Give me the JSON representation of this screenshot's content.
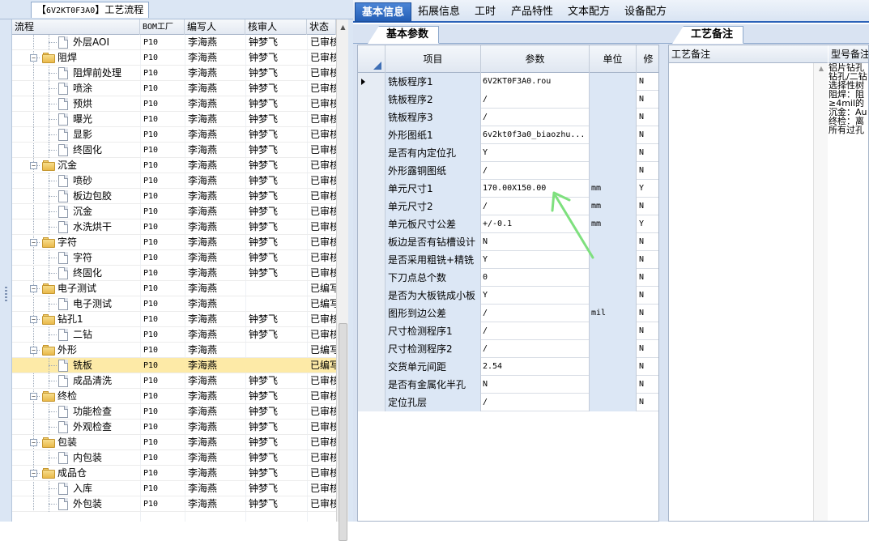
{
  "left": {
    "tab_code": "6V2KT0F3A0",
    "tab_bracket_open": "【",
    "tab_bracket_close": "】",
    "tab_title": "工艺流程",
    "columns": [
      "流程",
      "BOM工厂",
      "编写人",
      "核审人",
      "状态"
    ],
    "rows": [
      {
        "level": 1,
        "kind": "doc",
        "name": "外层AOI",
        "factory": "P10",
        "writer": "李海燕",
        "reviewer": "钟梦飞",
        "status": "已审核"
      },
      {
        "level": 0,
        "kind": "folder",
        "name": "阻焊",
        "factory": "P10",
        "writer": "李海燕",
        "reviewer": "钟梦飞",
        "status": "已审核"
      },
      {
        "level": 1,
        "kind": "doc",
        "name": "阻焊前处理",
        "factory": "P10",
        "writer": "李海燕",
        "reviewer": "钟梦飞",
        "status": "已审核"
      },
      {
        "level": 1,
        "kind": "doc",
        "name": "喷涂",
        "factory": "P10",
        "writer": "李海燕",
        "reviewer": "钟梦飞",
        "status": "已审核"
      },
      {
        "level": 1,
        "kind": "doc",
        "name": "预烘",
        "factory": "P10",
        "writer": "李海燕",
        "reviewer": "钟梦飞",
        "status": "已审核"
      },
      {
        "level": 1,
        "kind": "doc",
        "name": "曝光",
        "factory": "P10",
        "writer": "李海燕",
        "reviewer": "钟梦飞",
        "status": "已审核"
      },
      {
        "level": 1,
        "kind": "doc",
        "name": "显影",
        "factory": "P10",
        "writer": "李海燕",
        "reviewer": "钟梦飞",
        "status": "已审核"
      },
      {
        "level": 1,
        "kind": "doc",
        "name": "终固化",
        "factory": "P10",
        "writer": "李海燕",
        "reviewer": "钟梦飞",
        "status": "已审核"
      },
      {
        "level": 0,
        "kind": "folder",
        "name": "沉金",
        "factory": "P10",
        "writer": "李海燕",
        "reviewer": "钟梦飞",
        "status": "已审核"
      },
      {
        "level": 1,
        "kind": "doc",
        "name": "喷砂",
        "factory": "P10",
        "writer": "李海燕",
        "reviewer": "钟梦飞",
        "status": "已审核"
      },
      {
        "level": 1,
        "kind": "doc",
        "name": "板边包胶",
        "factory": "P10",
        "writer": "李海燕",
        "reviewer": "钟梦飞",
        "status": "已审核"
      },
      {
        "level": 1,
        "kind": "doc",
        "name": "沉金",
        "factory": "P10",
        "writer": "李海燕",
        "reviewer": "钟梦飞",
        "status": "已审核"
      },
      {
        "level": 1,
        "kind": "doc",
        "name": "水洗烘干",
        "factory": "P10",
        "writer": "李海燕",
        "reviewer": "钟梦飞",
        "status": "已审核"
      },
      {
        "level": 0,
        "kind": "folder",
        "name": "字符",
        "factory": "P10",
        "writer": "李海燕",
        "reviewer": "钟梦飞",
        "status": "已审核"
      },
      {
        "level": 1,
        "kind": "doc",
        "name": "字符",
        "factory": "P10",
        "writer": "李海燕",
        "reviewer": "钟梦飞",
        "status": "已审核"
      },
      {
        "level": 1,
        "kind": "doc",
        "name": "终固化",
        "factory": "P10",
        "writer": "李海燕",
        "reviewer": "钟梦飞",
        "status": "已审核"
      },
      {
        "level": 0,
        "kind": "folder",
        "name": "电子测试",
        "factory": "P10",
        "writer": "李海燕",
        "reviewer": "",
        "status": "已编写"
      },
      {
        "level": 1,
        "kind": "doc",
        "name": "电子测试",
        "factory": "P10",
        "writer": "李海燕",
        "reviewer": "",
        "status": "已编写"
      },
      {
        "level": 0,
        "kind": "folder",
        "name": "钻孔1",
        "factory": "P10",
        "writer": "李海燕",
        "reviewer": "钟梦飞",
        "status": "已审核"
      },
      {
        "level": 1,
        "kind": "doc",
        "name": "二钻",
        "factory": "P10",
        "writer": "李海燕",
        "reviewer": "钟梦飞",
        "status": "已审核"
      },
      {
        "level": 0,
        "kind": "folder",
        "name": "外形",
        "factory": "P10",
        "writer": "李海燕",
        "reviewer": "",
        "status": "已编写"
      },
      {
        "level": 1,
        "kind": "doc",
        "name": "铣板",
        "factory": "P10",
        "writer": "李海燕",
        "reviewer": "",
        "status": "已编写",
        "selected": true
      },
      {
        "level": 1,
        "kind": "doc",
        "name": "成品清洗",
        "factory": "P10",
        "writer": "李海燕",
        "reviewer": "钟梦飞",
        "status": "已审核"
      },
      {
        "level": 0,
        "kind": "folder",
        "name": "终检",
        "factory": "P10",
        "writer": "李海燕",
        "reviewer": "钟梦飞",
        "status": "已审核"
      },
      {
        "level": 1,
        "kind": "doc",
        "name": "功能检查",
        "factory": "P10",
        "writer": "李海燕",
        "reviewer": "钟梦飞",
        "status": "已审核"
      },
      {
        "level": 1,
        "kind": "doc",
        "name": "外观检查",
        "factory": "P10",
        "writer": "李海燕",
        "reviewer": "钟梦飞",
        "status": "已审核"
      },
      {
        "level": 0,
        "kind": "folder",
        "name": "包装",
        "factory": "P10",
        "writer": "李海燕",
        "reviewer": "钟梦飞",
        "status": "已审核"
      },
      {
        "level": 1,
        "kind": "doc",
        "name": "内包装",
        "factory": "P10",
        "writer": "李海燕",
        "reviewer": "钟梦飞",
        "status": "已审核"
      },
      {
        "level": 0,
        "kind": "folder",
        "name": "成品仓",
        "factory": "P10",
        "writer": "李海燕",
        "reviewer": "钟梦飞",
        "status": "已审核"
      },
      {
        "level": 1,
        "kind": "doc",
        "name": "入库",
        "factory": "P10",
        "writer": "李海燕",
        "reviewer": "钟梦飞",
        "status": "已审核"
      },
      {
        "level": 1,
        "kind": "doc",
        "name": "外包装",
        "factory": "P10",
        "writer": "李海燕",
        "reviewer": "钟梦飞",
        "status": "已审核"
      }
    ]
  },
  "top_tabs": [
    "基本信息",
    "拓展信息",
    "工时",
    "产品特性",
    "文本配方",
    "设备配方"
  ],
  "active_top_tab": 0,
  "mid": {
    "tab": "基本参数",
    "columns": [
      "项目",
      "参数",
      "单位",
      "修"
    ],
    "rows": [
      {
        "item": "铣板程序1",
        "param": "6V2KT0F3A0.rou",
        "unit": "",
        "mod": "N",
        "current": true
      },
      {
        "item": "铣板程序2",
        "param": "/",
        "unit": "",
        "mod": "N"
      },
      {
        "item": "铣板程序3",
        "param": "/",
        "unit": "",
        "mod": "N"
      },
      {
        "item": "外形图纸1",
        "param": "6v2kt0f3a0_biaozhu...",
        "unit": "",
        "mod": "N"
      },
      {
        "item": "是否有内定位孔",
        "param": "Y",
        "unit": "",
        "mod": "N"
      },
      {
        "item": "外形露铜图纸",
        "param": "/",
        "unit": "",
        "mod": "N"
      },
      {
        "item": "单元尺寸1",
        "param": "170.00X150.00",
        "unit": "mm",
        "mod": "Y"
      },
      {
        "item": "单元尺寸2",
        "param": "/",
        "unit": "mm",
        "mod": "N"
      },
      {
        "item": "单元板尺寸公差",
        "param": "+/-0.1",
        "unit": "mm",
        "mod": "Y"
      },
      {
        "item": "板边是否有钻槽设计",
        "param": "N",
        "unit": "",
        "mod": "N"
      },
      {
        "item": "是否采用粗铣+精铣",
        "param": "Y",
        "unit": "",
        "mod": "N"
      },
      {
        "item": "下刀点总个数",
        "param": "0",
        "unit": "",
        "mod": "N"
      },
      {
        "item": "是否为大板铣成小板",
        "param": "Y",
        "unit": "",
        "mod": "N"
      },
      {
        "item": "图形到边公差",
        "param": "/",
        "unit": "mil",
        "mod": "N"
      },
      {
        "item": "尺寸检测程序1",
        "param": "/",
        "unit": "",
        "mod": "N"
      },
      {
        "item": "尺寸检测程序2",
        "param": "/",
        "unit": "",
        "mod": "N"
      },
      {
        "item": "交货单元间距",
        "param": "2.54",
        "unit": "",
        "mod": "N"
      },
      {
        "item": "是否有金属化半孔",
        "param": "N",
        "unit": "",
        "mod": "N"
      },
      {
        "item": "定位孔层",
        "param": "/",
        "unit": "",
        "mod": "N"
      }
    ]
  },
  "right": {
    "tab": "工艺备注",
    "col1": "工艺备注",
    "col2": "型号备注",
    "remark_text": "铝片钻孔\n钻孔/二钻\n选择性树\n阻焊：阻\n≥4mil的\n沉金：Au\n终检：离\n所有过孔"
  },
  "colors": {
    "active_tab": "#2f6cc3",
    "selected_row": "#fdeaa7",
    "arrow": "#7ee07e"
  }
}
